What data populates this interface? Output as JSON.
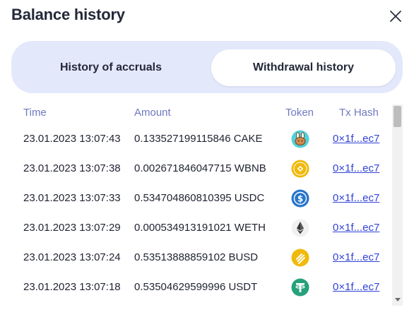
{
  "dialog": {
    "title": "Balance history"
  },
  "tabs": [
    {
      "label": "History of accruals",
      "active": false
    },
    {
      "label": "Withdrawal history",
      "active": true
    }
  ],
  "table": {
    "headers": {
      "time": "Time",
      "amount": "Amount",
      "token": "Token",
      "tx_hash": "Tx Hash"
    },
    "rows": [
      {
        "time": "23.01.2023 13:07:43",
        "amount": "0.133527199115846 CAKE",
        "token_icon": "cake-token-icon",
        "tx_hash": "0×1f...ec7"
      },
      {
        "time": "23.01.2023 13:07:38",
        "amount": "0.002671846047715 WBNB",
        "token_icon": "wbnb-token-icon",
        "tx_hash": "0×1f...ec7"
      },
      {
        "time": "23.01.2023 13:07:33",
        "amount": "0.534704860810395 USDC",
        "token_icon": "usdc-token-icon",
        "tx_hash": "0×1f...ec7"
      },
      {
        "time": "23.01.2023 13:07:29",
        "amount": "0.000534913191021 WETH",
        "token_icon": "weth-token-icon",
        "tx_hash": "0×1f...ec7"
      },
      {
        "time": "23.01.2023 13:07:24",
        "amount": "0.53513888859102 BUSD",
        "token_icon": "busd-token-icon",
        "tx_hash": "0×1f...ec7"
      },
      {
        "time": "23.01.2023 13:07:18",
        "amount": "0.53504629599996 USDT",
        "token_icon": "usdt-token-icon",
        "tx_hash": "0×1f...ec7"
      }
    ]
  },
  "colors": {
    "header_text": "#6f78bf",
    "tab_track": "#e4e8fb",
    "link": "#3142d8",
    "cake": "#53d0d8",
    "wbnb": "#f0b90b",
    "usdc": "#2775ca",
    "weth": "#f0f0f0",
    "busd": "#f0b90b",
    "usdt": "#26a17b"
  }
}
